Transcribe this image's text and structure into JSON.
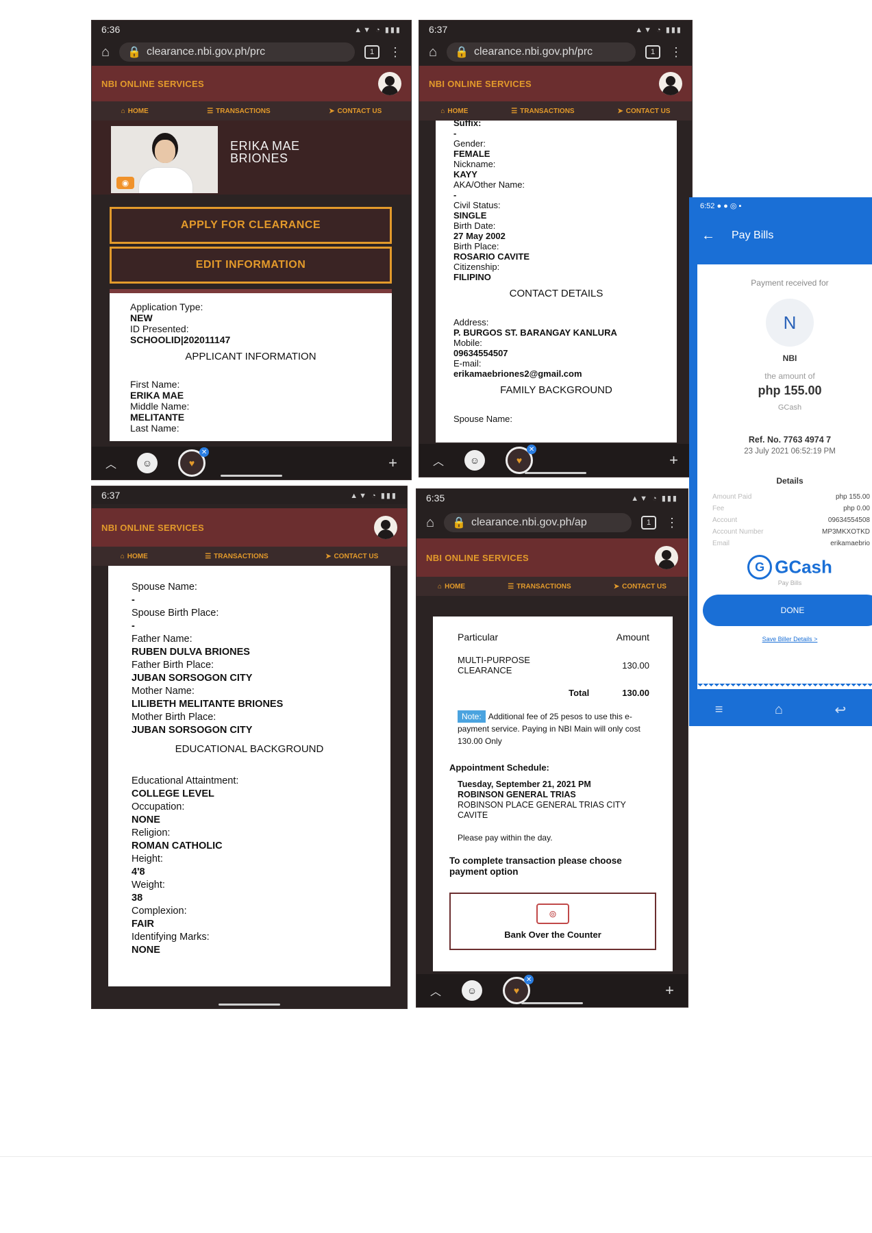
{
  "common": {
    "brand": "NBI ONLINE SERVICES",
    "nav": {
      "home": "HOME",
      "transactions": "TRANSACTIONS",
      "contact": "CONTACT US"
    },
    "url1": "clearance.nbi.gov.ph/prc",
    "url2": "clearance.nbi.gov.ph/ap",
    "tabcount": "1"
  },
  "screen1": {
    "time": "6:36",
    "name_line1": "ERIKA MAE",
    "name_line2": "BRIONES",
    "apply_button": "APPLY FOR CLEARANCE",
    "edit_button": "EDIT INFORMATION",
    "fields": [
      {
        "label": "Application Type:",
        "value": "NEW"
      },
      {
        "label": "ID Presented:",
        "value": "SCHOOLID|202011147"
      }
    ],
    "section": "APPLICANT INFORMATION",
    "fields2": [
      {
        "label": "First Name:",
        "value": "ERIKA MAE"
      },
      {
        "label": "Middle Name:",
        "value": "MELITANTE"
      },
      {
        "label": "Last Name:",
        "value": ""
      }
    ]
  },
  "screen2": {
    "time": "6:37",
    "top_label": "Suffix:",
    "fields": [
      {
        "label": "",
        "value": "-"
      },
      {
        "label": "Gender:",
        "value": "FEMALE"
      },
      {
        "label": "Nickname:",
        "value": "KAYY"
      },
      {
        "label": "AKA/Other Name:",
        "value": "-"
      },
      {
        "label": "Civil Status:",
        "value": "SINGLE"
      },
      {
        "label": "Birth Date:",
        "value": "27 May 2002"
      },
      {
        "label": "Birth Place:",
        "value": "ROSARIO CAVITE"
      },
      {
        "label": "Citizenship:",
        "value": "FILIPINO"
      }
    ],
    "section": "CONTACT DETAILS",
    "fields2": [
      {
        "label": "Address:",
        "value": "P. BURGOS ST. BARANGAY KANLURA"
      },
      {
        "label": "Mobile:",
        "value": "09634554507"
      },
      {
        "label": "E-mail:",
        "value": "erikamaebriones2@gmail.com"
      }
    ],
    "section2": "FAMILY BACKGROUND",
    "tail": "Spouse Name:"
  },
  "screen3": {
    "time": "6:37",
    "fields": [
      {
        "label": "Spouse Name:",
        "value": "-"
      },
      {
        "label": "Spouse Birth Place:",
        "value": "-"
      },
      {
        "label": "Father Name:",
        "value": "RUBEN DULVA BRIONES"
      },
      {
        "label": "Father Birth Place:",
        "value": "JUBAN SORSOGON CITY"
      },
      {
        "label": "Mother Name:",
        "value": "LILIBETH MELITANTE BRIONES"
      },
      {
        "label": "Mother Birth Place:",
        "value": "JUBAN SORSOGON CITY"
      }
    ],
    "section": "EDUCATIONAL BACKGROUND",
    "fields2": [
      {
        "label": "Educational Attaintment:",
        "value": "COLLEGE LEVEL"
      },
      {
        "label": "Occupation:",
        "value": "NONE"
      },
      {
        "label": "Religion:",
        "value": "ROMAN CATHOLIC"
      },
      {
        "label": "Height:",
        "value": "4'8"
      },
      {
        "label": "Weight:",
        "value": "38"
      },
      {
        "label": "Complexion:",
        "value": "FAIR"
      },
      {
        "label": "Identifying Marks:",
        "value": "NONE"
      }
    ]
  },
  "screen4": {
    "time": "6:35",
    "col_particular": "Particular",
    "col_amount": "Amount",
    "item_line1": "MULTI-PURPOSE",
    "item_line2": "CLEARANCE",
    "item_amount": "130.00",
    "total_label": "Total",
    "total_amount": "130.00",
    "note_badge": "Note:",
    "note_text": "Additional fee of 25 pesos to use this e-payment service. Paying in NBI Main will only cost 130.00 Only",
    "appt_title": "Appointment Schedule:",
    "appt_date": "Tuesday, September 21, 2021 PM",
    "appt_place": "ROBINSON GENERAL TRIAS",
    "appt_addr": "ROBINSON PLACE GENERAL TRIAS CITY CAVITE",
    "pay_within": "Please pay within the day.",
    "complete_text": "To complete transaction please choose payment option",
    "option_label": "Bank Over the Counter"
  },
  "gcash": {
    "time": "6:52",
    "title": "Pay Bills",
    "received_for": "Payment received for",
    "initial": "N",
    "biller": "NBI",
    "amount_of": "the amount of",
    "amount": "php 155.00",
    "via": "GCash",
    "ref": "Ref. No. 7763 4974 7",
    "datetime": "23 July 2021 06:52:19 PM",
    "details_title": "Details",
    "details": [
      {
        "label": "Amount Paid",
        "value": "php 155.00"
      },
      {
        "label": "Fee",
        "value": "php 0.00"
      },
      {
        "label": "Account",
        "value": "09634554508"
      },
      {
        "label": "Account Number",
        "value": "MP3MKXOTKD"
      },
      {
        "label": "Email",
        "value": "erikamaebrio"
      }
    ],
    "logo": "GCash",
    "logo_sub": "Pay Bills",
    "done": "DONE",
    "save_link": "Save Biller Details >",
    "brand_color": "#1a6fd6"
  },
  "colors": {
    "nbi_header": "#6b2e2f",
    "nbi_accent": "#e39a2b"
  }
}
